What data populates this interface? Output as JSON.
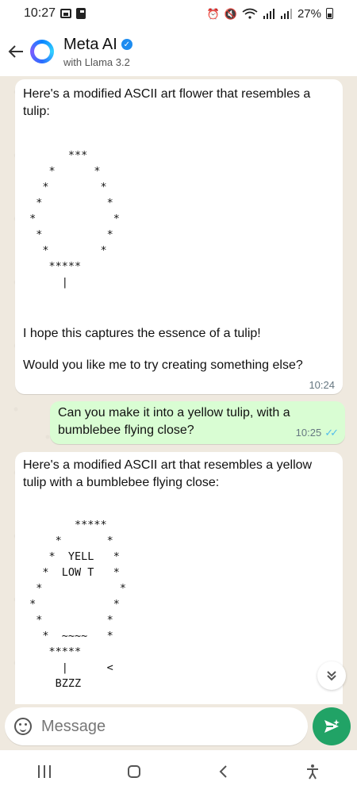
{
  "status_bar": {
    "time": "10:27",
    "battery": "27%"
  },
  "header": {
    "title": "Meta AI",
    "subtitle": "with Llama 3.2"
  },
  "messages": [
    {
      "from": "ai",
      "intro": "Here's a modified ASCII art flower that resembles a tulip:",
      "ascii": "       ***\n    *      *\n   *        *\n  *          *\n *            *\n  *          *\n   *        *\n    *****\n      |",
      "line2": "I hope this captures the essence of a tulip!",
      "line3": "Would you like me to try creating something else?",
      "time": "10:24"
    },
    {
      "from": "user",
      "text": "Can you make it into a yellow tulip, with a bumblebee flying close?",
      "time": "10:25"
    },
    {
      "from": "ai",
      "intro": "Here's a modified ASCII art that resembles a yellow tulip with a bumblebee flying close:",
      "ascii": "        *****\n     *       *\n    *  YELL   *\n   *  LOW T   *\n  *            *\n *            *\n  *          *\n   *  ~~~~   *\n    *****\n      |      <\n     BZZZ"
    }
  ],
  "composer": {
    "placeholder": "Message"
  },
  "icons": {
    "back": "arrow-left-icon",
    "send": "send-icon",
    "emoji": "emoji-icon",
    "scroll_down": "chevron-double-down-icon"
  },
  "colors": {
    "accent": "#21a366",
    "outgoing_bubble": "#d9fdd3",
    "read_ticks": "#53bdeb"
  }
}
